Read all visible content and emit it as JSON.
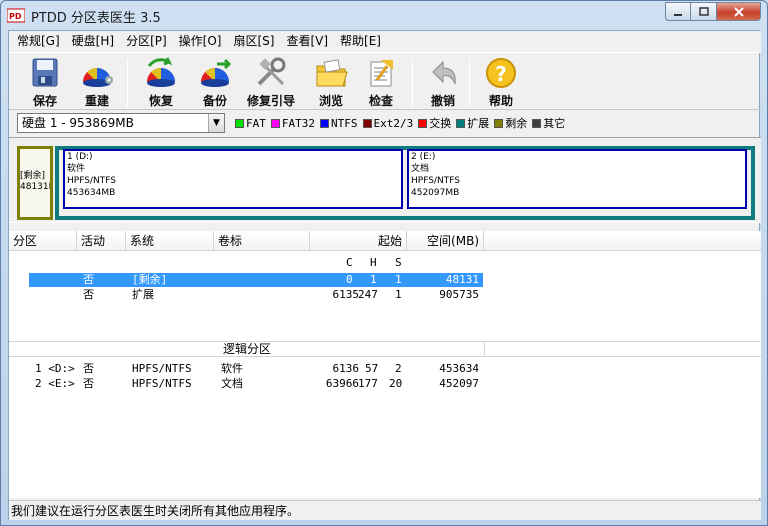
{
  "window": {
    "title": "PTDD 分区表医生 3.5"
  },
  "menu": [
    "常规[G]",
    "硬盘[H]",
    "分区[P]",
    "操作[O]",
    "扇区[S]",
    "查看[V]",
    "帮助[E]"
  ],
  "toolbar": [
    {
      "label": "保存",
      "icon": "save-icon"
    },
    {
      "label": "重建",
      "icon": "rebuild-icon"
    },
    {
      "label": "恢复",
      "icon": "restore-icon"
    },
    {
      "label": "备份",
      "icon": "backup-icon"
    },
    {
      "label": "修复引导",
      "icon": "repair-boot-icon"
    },
    {
      "label": "浏览",
      "icon": "browse-icon"
    },
    {
      "label": "检查",
      "icon": "check-icon"
    },
    {
      "label": "撤销",
      "icon": "undo-icon"
    },
    {
      "label": "帮助",
      "icon": "help-icon"
    }
  ],
  "disk": {
    "selected": "硬盘 1 - 953869MB"
  },
  "legend": [
    {
      "label": "FAT",
      "color": "#00e000"
    },
    {
      "label": "FAT32",
      "color": "#ff00ff"
    },
    {
      "label": "NTFS",
      "color": "#0000ff"
    },
    {
      "label": "Ext2/3",
      "color": "#800000"
    },
    {
      "label": "交换",
      "color": "#ff0000"
    },
    {
      "label": "扩展",
      "color": "#008080"
    },
    {
      "label": "剩余",
      "color": "#808000"
    },
    {
      "label": "其它",
      "color": "#404040"
    }
  ],
  "map": {
    "free": {
      "l1": "[剩余]",
      "l2": "48131M"
    },
    "parts": [
      {
        "l1": "1 (D:)",
        "l2": "软件",
        "l3": "HPFS/NTFS",
        "l4": "453634MB"
      },
      {
        "l1": "2 (E:)",
        "l2": "文档",
        "l3": "HPFS/NTFS",
        "l4": "452097MB"
      }
    ]
  },
  "table": {
    "headers": [
      "分区",
      "活动",
      "系统",
      "卷标",
      "起始",
      "空间(MB)"
    ],
    "chs": [
      "C",
      "H",
      "S"
    ],
    "primary_rows": [
      {
        "part": "",
        "active": "否",
        "system": "[剩余]",
        "label": "",
        "c": "0",
        "h": "1",
        "s": "1",
        "size": "48131"
      },
      {
        "part": "",
        "active": "否",
        "system": "扩展",
        "label": "",
        "c": "6135",
        "h": "247",
        "s": "1",
        "size": "905735"
      }
    ],
    "logical_header": "逻辑分区",
    "logical_rows": [
      {
        "part": "1 <D:>",
        "active": "否",
        "system": "HPFS/NTFS",
        "label": "软件",
        "c": "6136",
        "h": "57",
        "s": "2",
        "size": "453634"
      },
      {
        "part": "2 <E:>",
        "active": "否",
        "system": "HPFS/NTFS",
        "label": "文档",
        "c": "63966",
        "h": "177",
        "s": "20",
        "size": "452097"
      }
    ]
  },
  "status": "我们建议在运行分区表医生时关闭所有其他应用程序。"
}
